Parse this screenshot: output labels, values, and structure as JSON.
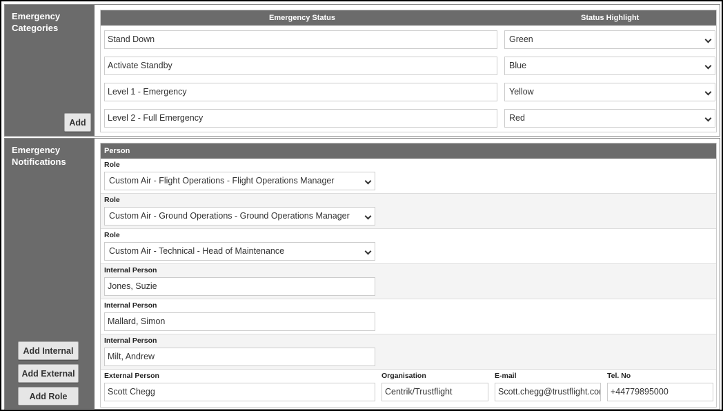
{
  "categories": {
    "title": "Emergency\nCategories",
    "add_label": "Add",
    "columns": {
      "status": "Emergency Status",
      "highlight": "Status Highlight"
    },
    "rows": [
      {
        "status": "Stand Down",
        "highlight": "Green"
      },
      {
        "status": "Activate Standby",
        "highlight": "Blue"
      },
      {
        "status": "Level 1 - Emergency",
        "highlight": "Yellow"
      },
      {
        "status": "Level 2 - Full Emergency",
        "highlight": "Red"
      }
    ]
  },
  "notifications": {
    "title": "Emergency\nNotifications",
    "buttons": {
      "add_internal": "Add Internal",
      "add_external": "Add External",
      "add_role": "Add Role"
    },
    "header": "Person",
    "roles": [
      {
        "label": "Role",
        "value": "Custom Air - Flight Operations - Flight Operations Manager"
      },
      {
        "label": "Role",
        "value": "Custom Air - Ground Operations - Ground Operations Manager"
      },
      {
        "label": "Role",
        "value": "Custom Air - Technical - Head of Maintenance"
      }
    ],
    "internal": [
      {
        "label": "Internal Person",
        "value": "Jones, Suzie"
      },
      {
        "label": "Internal Person",
        "value": "Mallard, Simon"
      },
      {
        "label": "Internal Person",
        "value": "Milt, Andrew"
      }
    ],
    "external": {
      "label": "External Person",
      "value": "Scott Chegg",
      "org_label": "Organisation",
      "org": "Centrik/Trustflight",
      "email_label": "E-mail",
      "email": "Scott.chegg@trustflight.cor",
      "tel_label": "Tel. No",
      "tel": "+44779895000"
    }
  }
}
